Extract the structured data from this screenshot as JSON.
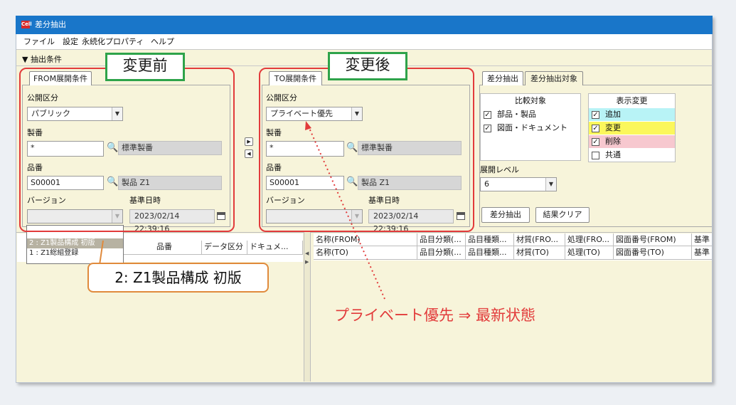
{
  "app": {
    "title": "差分抽出",
    "icon_text": "Cell"
  },
  "menu": [
    "ファイル",
    "設定",
    "永続化プロパティ",
    "ヘルプ"
  ],
  "section_header": "▼ 抽出条件",
  "from_panel": {
    "tab": "FROM展開条件",
    "annotation": "変更前",
    "kokai_label": "公開区分",
    "kokai_value": "パブリック",
    "seiban_label": "製番",
    "seiban_value": "*",
    "seiban_name": "標準製番",
    "hinban_label": "品番",
    "hinban_value": "S00001",
    "hinban_name": "製品 Z1",
    "version_label": "バージョン",
    "version_value": "",
    "kijun_label": "基準日時",
    "kijun_value": "2023/02/14 22:39:16",
    "version_options": [
      "2 : Z1製品構成 初版",
      "1 : Z1総組登録"
    ]
  },
  "to_panel": {
    "tab": "TO展開条件",
    "annotation": "変更後",
    "kokai_label": "公開区分",
    "kokai_value": "プライベート優先",
    "seiban_label": "製番",
    "seiban_value": "*",
    "seiban_name": "標準製番",
    "hinban_label": "品番",
    "hinban_value": "S00001",
    "hinban_name": "製品 Z1",
    "version_label": "バージョン",
    "version_value": "",
    "kijun_label": "基準日時",
    "kijun_value": "2023/02/14 22:39:16"
  },
  "right_panel": {
    "tabs": [
      "差分抽出",
      "差分抽出対象"
    ],
    "compare_title": "比較対象",
    "compare_items": [
      {
        "label": "部品・製品",
        "checked": true
      },
      {
        "label": "図面・ドキュメント",
        "checked": true
      }
    ],
    "display_title": "表示変更",
    "display_items": [
      {
        "label": "追加",
        "checked": true,
        "color": "#b8f3f6"
      },
      {
        "label": "変更",
        "checked": true,
        "color": "#fbf75c"
      },
      {
        "label": "削除",
        "checked": true,
        "color": "#f7c8cf"
      },
      {
        "label": "共通",
        "checked": false,
        "color": "#ffffff"
      }
    ],
    "level_label": "展開レベル",
    "level_value": "6",
    "extract_button": "差分抽出",
    "clear_button": "結果クリア"
  },
  "left_grid": {
    "headers": [
      "品番",
      "データ区分",
      "ドキュメ..."
    ]
  },
  "right_grid": {
    "row1": [
      "名称(FROM)",
      "品目分類(...",
      "品目種類...",
      "材質(FRO...",
      "処理(FRO...",
      "図面番号(FROM)",
      "基準"
    ],
    "row2": [
      "名称(TO)",
      "品目分類(...",
      "品目種類...",
      "材質(TO)",
      "処理(TO)",
      "図面番号(TO)",
      "基準"
    ]
  },
  "callout": "2: Z1製品構成 初版",
  "note": "プライベート優先 ⇒ 最新状態"
}
